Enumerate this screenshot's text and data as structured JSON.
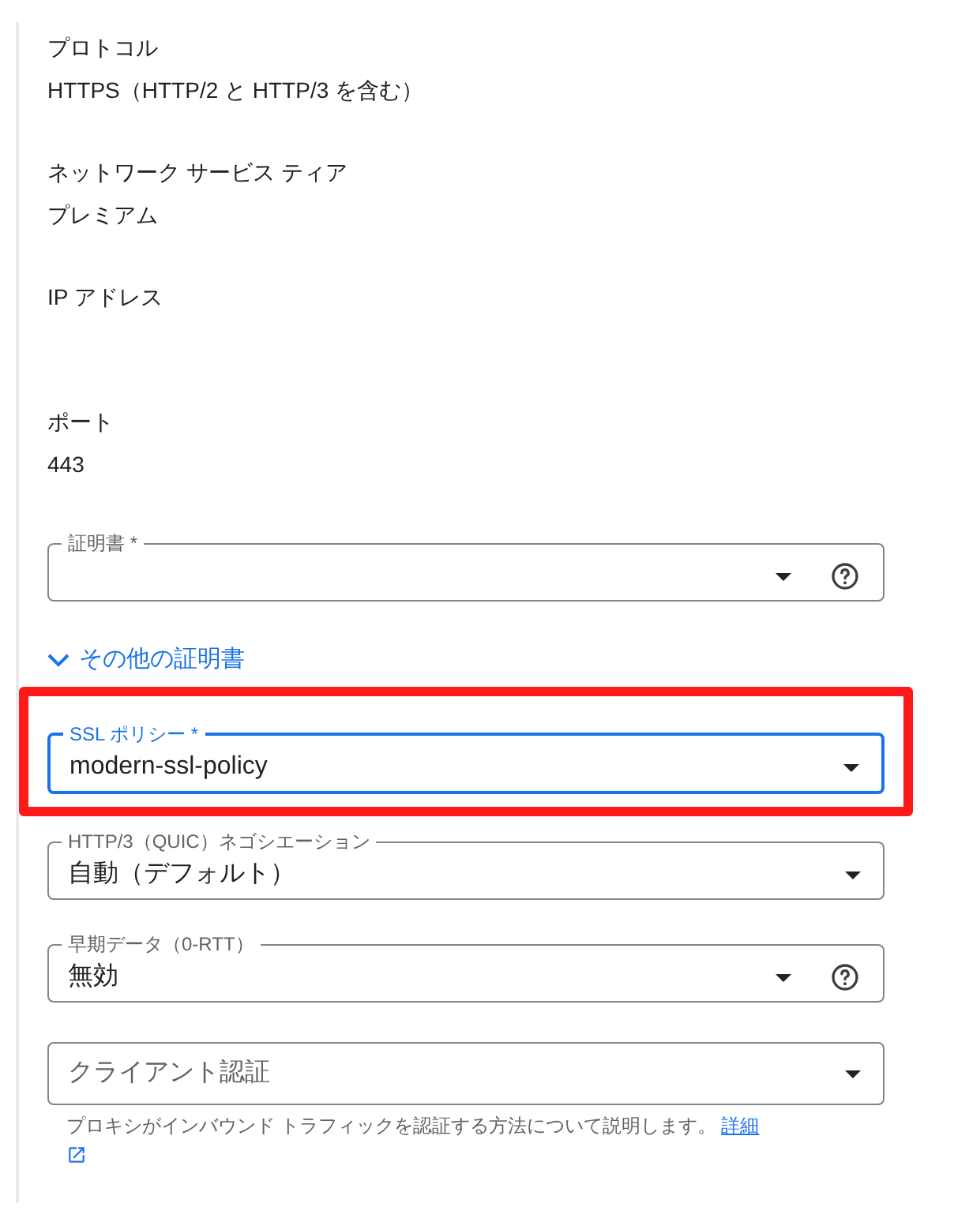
{
  "details": [
    {
      "label": "プロトコル",
      "value": "HTTPS（HTTP/2 と HTTP/3 を含む）"
    },
    {
      "label": "ネットワーク サービス ティア",
      "value": "プレミアム"
    },
    {
      "label": "IP アドレス"
    },
    {
      "label": "ポート",
      "value": "443"
    }
  ],
  "certificate_field": {
    "label": "証明書 *",
    "focused": false,
    "help": true
  },
  "more_certificates": {
    "label": "その他の証明書",
    "expanded": false
  },
  "fields": [
    {
      "label": "SSL ポリシー *",
      "value": "modern-ssl-policy",
      "focused": true,
      "highlighted": true,
      "help": false
    },
    {
      "label": "HTTP/3（QUIC）ネゴシエーション",
      "value": "自動（デフォルト）",
      "focused": false,
      "highlighted": false,
      "help": false
    },
    {
      "label": "早期データ（0-RTT）",
      "value": "無効",
      "focused": false,
      "highlighted": false,
      "help": true
    },
    {
      "placeholder": "クライアント認証",
      "focused": false,
      "highlighted": false,
      "help": false
    }
  ],
  "help_text": {
    "text": "プロキシがインバウンド トラフィックを認証する方法について説明します。",
    "link": "詳細"
  }
}
